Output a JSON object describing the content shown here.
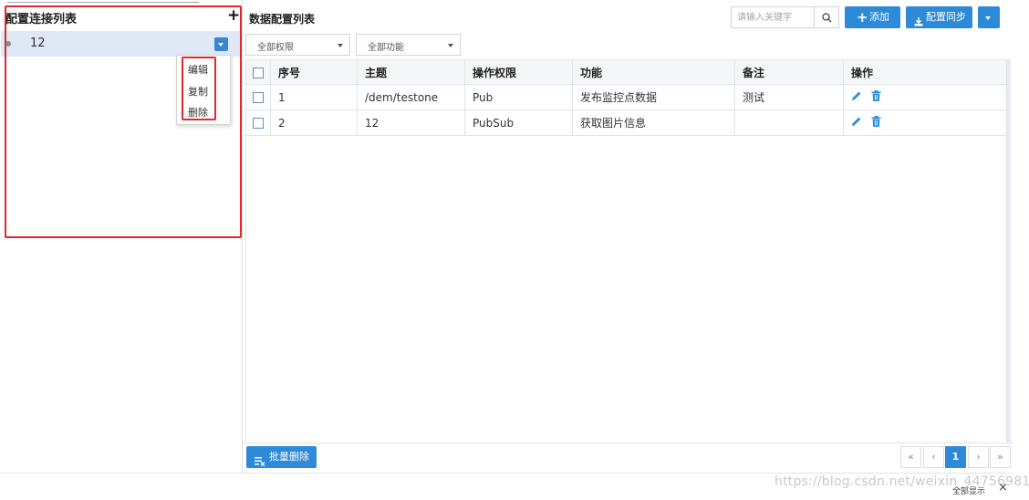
{
  "left_panel": {
    "title": "配置连接列表",
    "add_icon": "plus-icon",
    "items": [
      {
        "label": "12",
        "selected": true
      }
    ],
    "context_menu": {
      "items": [
        "编辑",
        "复制",
        "删除"
      ]
    }
  },
  "main": {
    "title": "数据配置列表",
    "search": {
      "placeholder": "请输入关键字",
      "value": "",
      "icon": "search-icon"
    },
    "buttons": {
      "add": "添加",
      "sync": "配置同步",
      "batch_delete": "批量删除"
    },
    "filters": {
      "permission": "全部权限",
      "function": "全部功能"
    },
    "table": {
      "headers": [
        "序号",
        "主题",
        "操作权限",
        "功能",
        "备注",
        "操作"
      ],
      "rows": [
        {
          "index": "1",
          "topic": "/dem/testone",
          "permission": "Pub",
          "function": "发布监控点数据",
          "note": "测试"
        },
        {
          "index": "2",
          "topic": "12",
          "permission": "PubSub",
          "function": "获取图片信息",
          "note": ""
        }
      ],
      "row_action_icons": [
        "edit-icon",
        "trash-icon"
      ]
    },
    "pagination": {
      "first": "«",
      "prev": "‹",
      "current": "1",
      "next": "›",
      "last": "»"
    }
  },
  "bottom_bar": {
    "watermark": "https://blog.csdn.net/weixin_44756981",
    "show_all": "全部显示",
    "close": "×"
  },
  "colors": {
    "primary": "#2d8ad8",
    "selected_row": "#dfe8f6",
    "highlight_box": "#e0292b"
  }
}
